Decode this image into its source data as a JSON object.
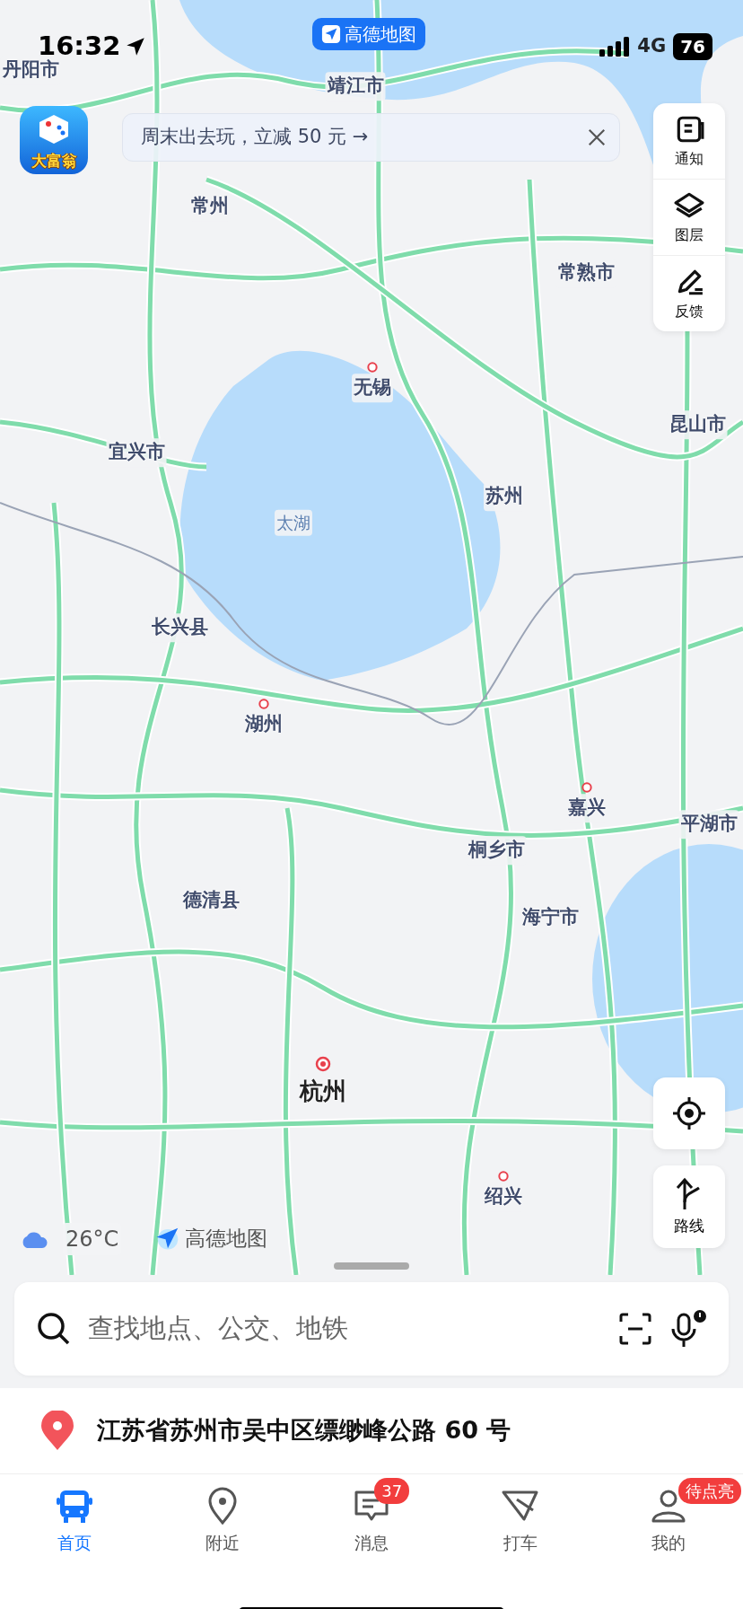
{
  "status_bar": {
    "time": "16:32",
    "network": "4G",
    "battery": "76"
  },
  "app_badge": {
    "label": "高德地图"
  },
  "game_icon": {
    "label": "大富翁"
  },
  "promo_banner": {
    "text": "周末出去玩，立减 50 元 →"
  },
  "side_tools": [
    {
      "label": "通知",
      "kind": "notice"
    },
    {
      "label": "图层",
      "kind": "layers"
    },
    {
      "label": "反馈",
      "kind": "feedback"
    }
  ],
  "map": {
    "labels": [
      {
        "text": "丹阳市",
        "kind": "city",
        "marker": false
      },
      {
        "text": "靖江市",
        "kind": "city",
        "marker": false
      },
      {
        "text": "常州",
        "kind": "city",
        "marker": false
      },
      {
        "text": "常熟市",
        "kind": "city",
        "marker": false
      },
      {
        "text": "无锡",
        "kind": "city",
        "marker": true
      },
      {
        "text": "宜兴市",
        "kind": "city",
        "marker": false
      },
      {
        "text": "昆山市",
        "kind": "city",
        "marker": false
      },
      {
        "text": "苏州",
        "kind": "city",
        "marker": false
      },
      {
        "text": "太湖",
        "kind": "water",
        "marker": false
      },
      {
        "text": "长兴县",
        "kind": "city",
        "marker": false
      },
      {
        "text": "湖州",
        "kind": "city",
        "marker": true
      },
      {
        "text": "嘉兴",
        "kind": "city",
        "marker": true
      },
      {
        "text": "平湖市",
        "kind": "city",
        "marker": false
      },
      {
        "text": "桐乡市",
        "kind": "city",
        "marker": false
      },
      {
        "text": "德清县",
        "kind": "city",
        "marker": false
      },
      {
        "text": "海宁市",
        "kind": "city",
        "marker": false
      },
      {
        "text": "杭州",
        "kind": "capital",
        "marker": true
      },
      {
        "text": "绍兴",
        "kind": "city",
        "marker": true
      }
    ],
    "weather": {
      "temperature": "26°C"
    },
    "logo": "高德地图"
  },
  "route_button": {
    "label": "路线"
  },
  "search": {
    "placeholder": "查找地点、公交、地铁"
  },
  "location": {
    "address": "江苏省苏州市吴中区缥缈峰公路 60 号"
  },
  "tabs": [
    {
      "label": "首页",
      "kind": "home",
      "selected": true
    },
    {
      "label": "附近",
      "kind": "nearby",
      "selected": false
    },
    {
      "label": "消息",
      "kind": "messages",
      "selected": false,
      "badge": "37"
    },
    {
      "label": "打车",
      "kind": "taxi",
      "selected": false
    },
    {
      "label": "我的",
      "kind": "profile",
      "selected": false,
      "badge": "待点亮"
    }
  ]
}
